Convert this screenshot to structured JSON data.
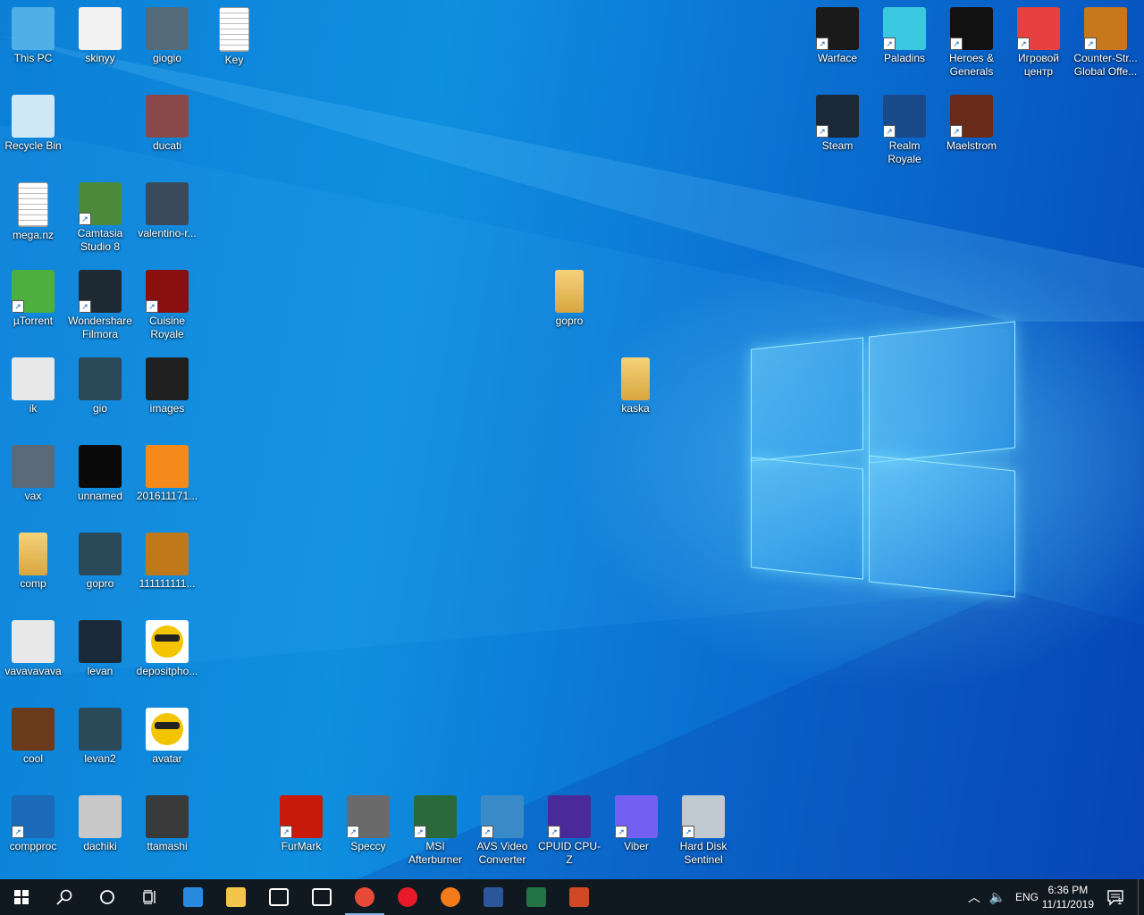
{
  "desktop": {
    "icons": [
      {
        "label": "This PC",
        "icon": "this-pc-icon",
        "color": "#4fb0e8"
      },
      {
        "label": "skinyy",
        "icon": "screenshot-file-icon",
        "color": "#f2f2f2"
      },
      {
        "label": "giogio",
        "icon": "photo-file-icon",
        "color": "#556b7a"
      },
      {
        "label": "Key",
        "icon": "text-document-icon",
        "color": "#ffffff"
      },
      {
        "label": "Recycle Bin",
        "icon": "recycle-bin-icon",
        "color": "#cfe8f5"
      },
      {
        "label": "ducati",
        "icon": "photo-file-icon",
        "color": "#8a4a4a"
      },
      {
        "label": "mega.nz",
        "icon": "text-document-icon",
        "color": "#ffffff"
      },
      {
        "label": "Camtasia Studio 8",
        "icon": "camtasia-icon",
        "color": "#4b8a3a"
      },
      {
        "label": "valentino-r...",
        "icon": "photo-file-icon",
        "color": "#3a4a5a"
      },
      {
        "label": "µTorrent",
        "icon": "utorrent-icon",
        "color": "#4caf3e"
      },
      {
        "label": "Wondershare Filmora",
        "icon": "filmora-icon",
        "color": "#1e2a33"
      },
      {
        "label": "Cuisine Royale",
        "icon": "cuisine-royale-icon",
        "color": "#8a1010"
      },
      {
        "label": "ik",
        "icon": "screenshot-file-icon",
        "color": "#e8e8e8"
      },
      {
        "label": "gio",
        "icon": "screenshot-file-icon",
        "color": "#2a4a5a"
      },
      {
        "label": "images",
        "icon": "photo-file-icon",
        "color": "#202020"
      },
      {
        "label": "vax",
        "icon": "photo-file-icon",
        "color": "#5a6a78"
      },
      {
        "label": "unnamed",
        "icon": "street-baron-icon",
        "color": "#0a0a0a"
      },
      {
        "label": "201611171...",
        "icon": "photo-file-icon",
        "color": "#f58a1a"
      },
      {
        "label": "comp",
        "icon": "folder-icon",
        "color": "#e8c06a"
      },
      {
        "label": "gopro",
        "icon": "screenshot-file-icon",
        "color": "#2a4a5a"
      },
      {
        "label": "111111111...",
        "icon": "photo-file-icon",
        "color": "#c0781a"
      },
      {
        "label": "vavavavava",
        "icon": "screenshot-file-icon",
        "color": "#e8e8e8"
      },
      {
        "label": "levan",
        "icon": "screenshot-file-icon",
        "color": "#1a2a3a"
      },
      {
        "label": "depositpho...",
        "icon": "emoji-image-icon",
        "color": "#f5c400"
      },
      {
        "label": "cool",
        "icon": "photo-file-icon",
        "color": "#6a3a1a"
      },
      {
        "label": "levan2",
        "icon": "screenshot-file-icon",
        "color": "#2a4a5a"
      },
      {
        "label": "avatar",
        "icon": "emoji-image-icon",
        "color": "#f5c400"
      },
      {
        "label": "compproc",
        "icon": "intel-processor-icon",
        "color": "#1a6ab8"
      },
      {
        "label": "dachiki",
        "icon": "photo-file-icon",
        "color": "#c8c8c8"
      },
      {
        "label": "ttamashi",
        "icon": "screenshot-file-icon",
        "color": "#3a3a3a"
      },
      {
        "label": "gopro",
        "icon": "folder-icon",
        "color": "#e8c06a"
      },
      {
        "label": "kaska",
        "icon": "folder-icon",
        "color": "#e8c06a"
      },
      {
        "label": "Warface",
        "icon": "warface-icon",
        "color": "#1a1a1a"
      },
      {
        "label": "Paladins",
        "icon": "paladins-icon",
        "color": "#3ac8e0"
      },
      {
        "label": "Heroes & Generals",
        "icon": "heroes-generals-icon",
        "color": "#111111"
      },
      {
        "label": "Игровой центр",
        "icon": "game-center-icon",
        "color": "#e84040"
      },
      {
        "label": "Counter-Str... Global Offe...",
        "icon": "csgo-icon",
        "color": "#c8781a"
      },
      {
        "label": "Steam",
        "icon": "steam-icon",
        "color": "#1b2838"
      },
      {
        "label": "Realm Royale",
        "icon": "realm-royale-icon",
        "color": "#1a4a8a"
      },
      {
        "label": "Maelstrom",
        "icon": "maelstrom-icon",
        "color": "#6a2a1a"
      },
      {
        "label": "FurMark",
        "icon": "furmark-icon",
        "color": "#c81a0a"
      },
      {
        "label": "Speccy",
        "icon": "speccy-icon",
        "color": "#6a6a6a"
      },
      {
        "label": "MSI Afterburner",
        "icon": "msi-afterburner-icon",
        "color": "#2a6a3a"
      },
      {
        "label": "AVS Video Converter",
        "icon": "avs-video-converter-icon",
        "color": "#3a8ac8"
      },
      {
        "label": "CPUID CPU-Z",
        "icon": "cpu-z-icon",
        "color": "#4a2a9a"
      },
      {
        "label": "Viber",
        "icon": "viber-icon",
        "color": "#7360f2"
      },
      {
        "label": "Hard Disk Sentinel",
        "icon": "hard-disk-sentinel-icon",
        "color": "#c0c8d0"
      }
    ]
  },
  "taskbar": {
    "apps": [
      {
        "name": "start",
        "icon": "windows-start-icon",
        "color": "#ffffff"
      },
      {
        "name": "search",
        "icon": "search-icon",
        "color": "#ffffff"
      },
      {
        "name": "cortana",
        "icon": "cortana-icon",
        "color": "#ffffff"
      },
      {
        "name": "task-view",
        "icon": "task-view-icon",
        "color": "#ffffff"
      },
      {
        "name": "edge",
        "icon": "edge-icon",
        "color": "#2a8ae0"
      },
      {
        "name": "file-explorer",
        "icon": "file-explorer-icon",
        "color": "#f5c44a"
      },
      {
        "name": "store",
        "icon": "store-icon",
        "color": "#ffffff"
      },
      {
        "name": "mail",
        "icon": "mail-icon",
        "color": "#ffffff"
      },
      {
        "name": "chrome",
        "icon": "chrome-icon",
        "color": "#e84a3a"
      },
      {
        "name": "opera",
        "icon": "opera-icon",
        "color": "#e81a2a"
      },
      {
        "name": "firefox",
        "icon": "firefox-icon",
        "color": "#f57a1a"
      },
      {
        "name": "word",
        "icon": "word-icon",
        "color": "#2b579a"
      },
      {
        "name": "excel",
        "icon": "excel-icon",
        "color": "#217346"
      },
      {
        "name": "powerpoint",
        "icon": "powerpoint-icon",
        "color": "#d24726"
      }
    ],
    "tray": {
      "language": "ENG",
      "time": "6:36 PM",
      "date": "11/11/2019",
      "notification_count": "1"
    }
  }
}
